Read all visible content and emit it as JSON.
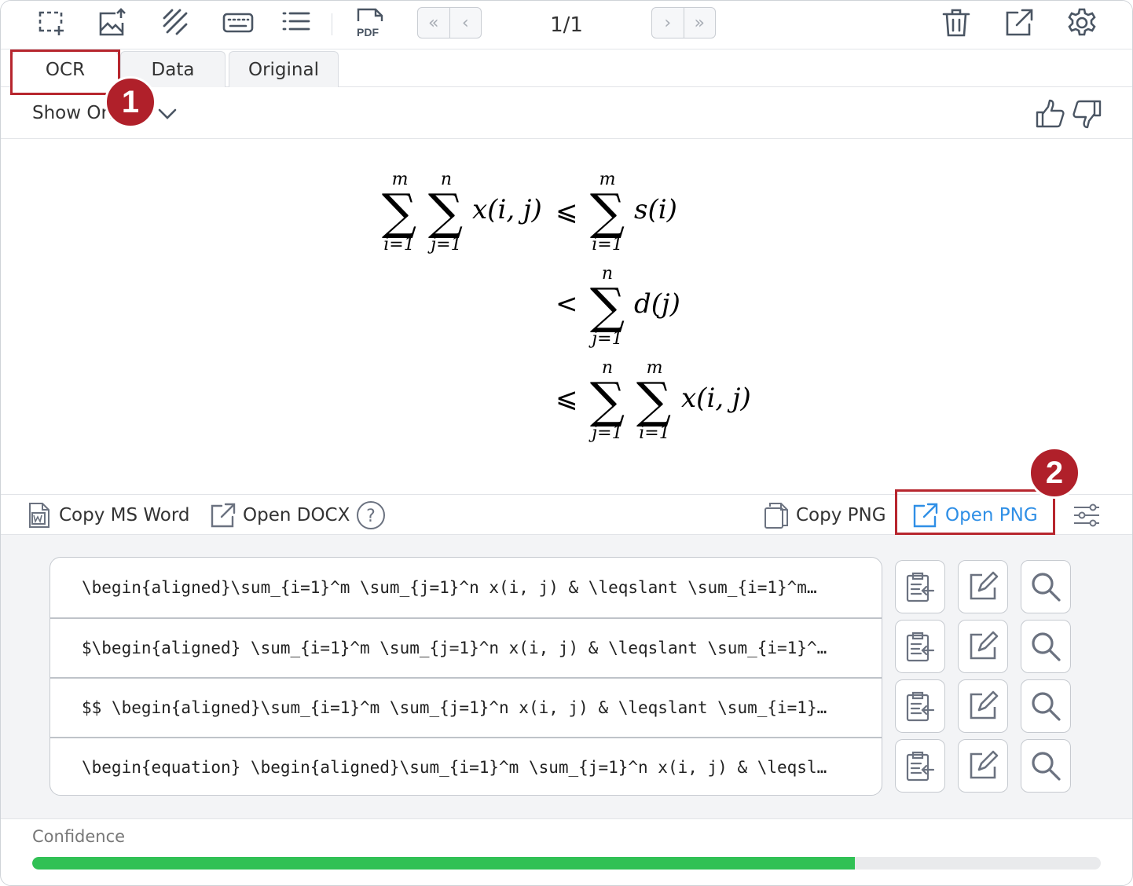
{
  "toolbar": {
    "icons": [
      "select-region-icon",
      "upload-image-icon",
      "handwriting-icon",
      "keyboard-icon",
      "list-icon",
      "pdf-icon",
      "trash-icon",
      "open-external-icon",
      "settings-icon"
    ],
    "pdf_text": "PDF",
    "page_indicator": "1/1",
    "first_label": "«",
    "prev_label": "‹",
    "next_label": "›",
    "last_label": "»"
  },
  "tabs": [
    {
      "label": "OCR",
      "active": true
    },
    {
      "label": "Data",
      "active": false
    },
    {
      "label": "Original",
      "active": false
    }
  ],
  "show_original": {
    "label": "Show Ori"
  },
  "annotations": {
    "badge1": "1",
    "badge2": "2",
    "color": "#b7262e"
  },
  "actions": {
    "copy_ms_word": "Copy MS Word",
    "open_docx": "Open DOCX",
    "help": "?",
    "copy_png": "Copy PNG",
    "open_png": "Open PNG"
  },
  "code_results": [
    "\\begin{aligned}\\sum_{i=1}^m \\sum_{j=1}^n x(i, j) & \\leqslant \\sum_{i=1}^m…",
    "$\\begin{aligned} \\sum_{i=1}^m \\sum_{j=1}^n x(i, j) & \\leqslant \\sum_{i=1}^…",
    "$$ \\begin{aligned}\\sum_{i=1}^m \\sum_{j=1}^n x(i, j) & \\leqslant \\sum_{i=1}…",
    "\\begin{equation} \\begin{aligned}\\sum_{i=1}^m \\sum_{j=1}^n x(i, j) & \\leqsl…"
  ],
  "row_buttons": [
    "copy-to-clipboard-icon",
    "edit-icon",
    "search-icon"
  ],
  "confidence": {
    "label": "Confidence",
    "value": 0.77,
    "color": "#31c155"
  },
  "formula": {
    "sum": "∑",
    "m": "m",
    "n": "n",
    "i1": "i=1",
    "j1": "j=1",
    "xij": "x(i, j)",
    "si": "s(i)",
    "dj": "d(j)",
    "leq": "⩽",
    "lt": "<"
  },
  "colors": {
    "accent": "#2f8fe6",
    "annotation": "#b7262e",
    "confidence": "#31c155"
  }
}
